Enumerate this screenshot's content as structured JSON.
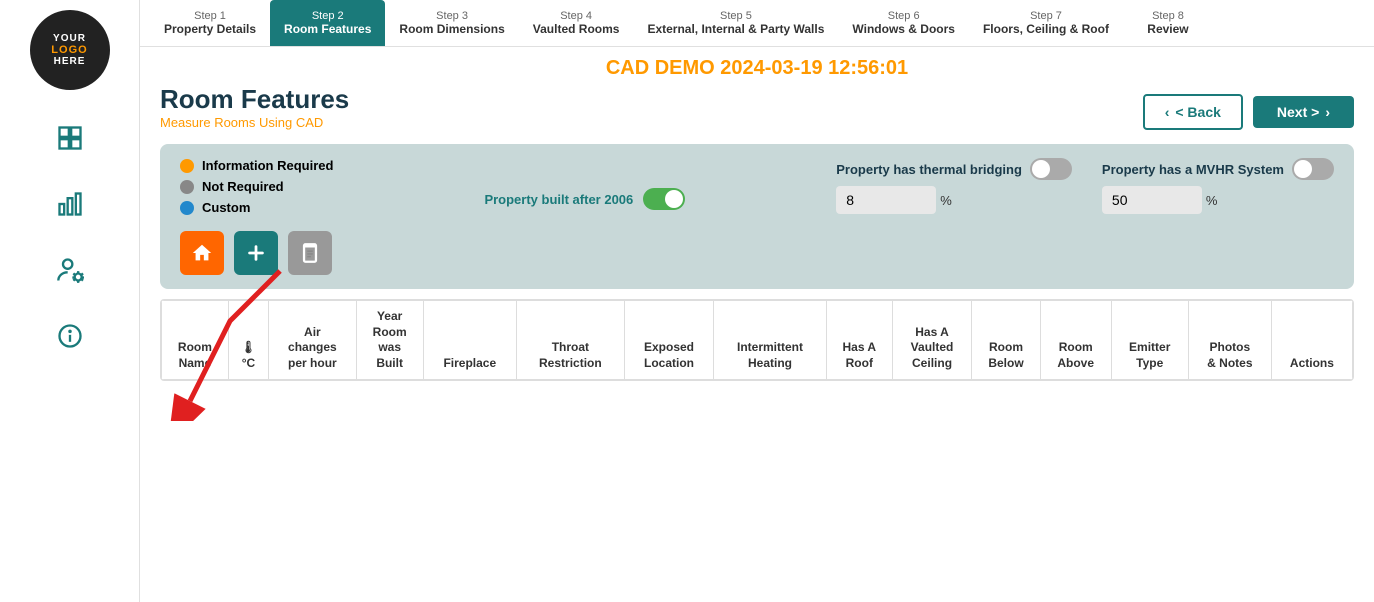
{
  "logo": {
    "line1": "YOUR",
    "line2": "LOGO",
    "line3": "HERE"
  },
  "stepper": {
    "steps": [
      {
        "label": "Step 1",
        "name": "Property Details",
        "active": false
      },
      {
        "label": "Step 2",
        "name": "Room Features",
        "active": true
      },
      {
        "label": "Step 3",
        "name": "Room Dimensions",
        "active": false
      },
      {
        "label": "Step 4",
        "name": "Vaulted Rooms",
        "active": false
      },
      {
        "label": "Step 5",
        "name": "External, Internal & Party Walls",
        "active": false
      },
      {
        "label": "Step 6",
        "name": "Windows & Doors",
        "active": false
      },
      {
        "label": "Step 7",
        "name": "Floors, Ceiling & Roof",
        "active": false
      },
      {
        "label": "Step 8",
        "name": "Review",
        "active": false
      }
    ]
  },
  "demo_title": "CAD DEMO 2024-03-19 12:56:01",
  "page_title": "Room Features",
  "page_subtitle": "Measure Rooms Using CAD",
  "buttons": {
    "back": "< Back",
    "next": "Next >"
  },
  "info_panel": {
    "legend": [
      {
        "color": "orange",
        "label": "Information Required"
      },
      {
        "color": "gray",
        "label": "Not Required"
      },
      {
        "color": "blue",
        "label": "Custom"
      }
    ],
    "property_built_label": "Property built after 2006",
    "thermal_bridging_label": "Property has thermal bridging",
    "thermal_bridging_value": "8",
    "thermal_bridging_unit": "%",
    "mvhr_label": "Property has a MVHR System",
    "mvhr_value": "50",
    "mvhr_unit": "%"
  },
  "table": {
    "headers": [
      "Room\nName",
      "🌡\n°C",
      "Air\nchanges\nper hour",
      "Year\nRoom\nwas\nBuilt",
      "Fireplace",
      "Throat\nRestriction",
      "Exposed\nLocation",
      "Intermittent\nHeating",
      "Has A\nRoof",
      "Has A\nVaulted\nCeiling",
      "Room\nBelow",
      "Room\nAbove",
      "Emitter\nType",
      "Photos\n& Notes",
      "Actions"
    ]
  }
}
